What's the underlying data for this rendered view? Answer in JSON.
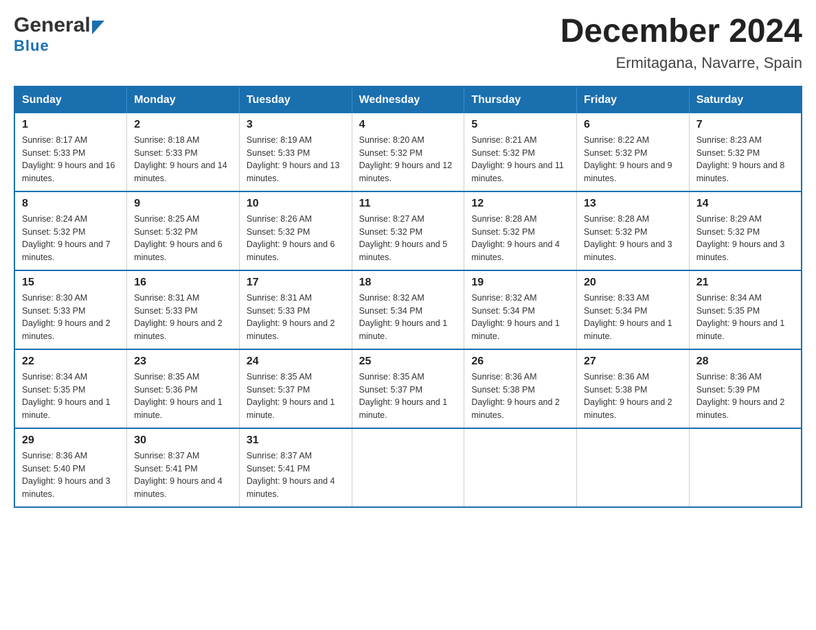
{
  "logo": {
    "general": "General",
    "blue": "Blue"
  },
  "title": {
    "month": "December 2024",
    "location": "Ermitagana, Navarre, Spain"
  },
  "days_of_week": [
    "Sunday",
    "Monday",
    "Tuesday",
    "Wednesday",
    "Thursday",
    "Friday",
    "Saturday"
  ],
  "weeks": [
    [
      {
        "day": "1",
        "sunrise": "8:17 AM",
        "sunset": "5:33 PM",
        "daylight": "9 hours and 16 minutes."
      },
      {
        "day": "2",
        "sunrise": "8:18 AM",
        "sunset": "5:33 PM",
        "daylight": "9 hours and 14 minutes."
      },
      {
        "day": "3",
        "sunrise": "8:19 AM",
        "sunset": "5:33 PM",
        "daylight": "9 hours and 13 minutes."
      },
      {
        "day": "4",
        "sunrise": "8:20 AM",
        "sunset": "5:32 PM",
        "daylight": "9 hours and 12 minutes."
      },
      {
        "day": "5",
        "sunrise": "8:21 AM",
        "sunset": "5:32 PM",
        "daylight": "9 hours and 11 minutes."
      },
      {
        "day": "6",
        "sunrise": "8:22 AM",
        "sunset": "5:32 PM",
        "daylight": "9 hours and 9 minutes."
      },
      {
        "day": "7",
        "sunrise": "8:23 AM",
        "sunset": "5:32 PM",
        "daylight": "9 hours and 8 minutes."
      }
    ],
    [
      {
        "day": "8",
        "sunrise": "8:24 AM",
        "sunset": "5:32 PM",
        "daylight": "9 hours and 7 minutes."
      },
      {
        "day": "9",
        "sunrise": "8:25 AM",
        "sunset": "5:32 PM",
        "daylight": "9 hours and 6 minutes."
      },
      {
        "day": "10",
        "sunrise": "8:26 AM",
        "sunset": "5:32 PM",
        "daylight": "9 hours and 6 minutes."
      },
      {
        "day": "11",
        "sunrise": "8:27 AM",
        "sunset": "5:32 PM",
        "daylight": "9 hours and 5 minutes."
      },
      {
        "day": "12",
        "sunrise": "8:28 AM",
        "sunset": "5:32 PM",
        "daylight": "9 hours and 4 minutes."
      },
      {
        "day": "13",
        "sunrise": "8:28 AM",
        "sunset": "5:32 PM",
        "daylight": "9 hours and 3 minutes."
      },
      {
        "day": "14",
        "sunrise": "8:29 AM",
        "sunset": "5:32 PM",
        "daylight": "9 hours and 3 minutes."
      }
    ],
    [
      {
        "day": "15",
        "sunrise": "8:30 AM",
        "sunset": "5:33 PM",
        "daylight": "9 hours and 2 minutes."
      },
      {
        "day": "16",
        "sunrise": "8:31 AM",
        "sunset": "5:33 PM",
        "daylight": "9 hours and 2 minutes."
      },
      {
        "day": "17",
        "sunrise": "8:31 AM",
        "sunset": "5:33 PM",
        "daylight": "9 hours and 2 minutes."
      },
      {
        "day": "18",
        "sunrise": "8:32 AM",
        "sunset": "5:34 PM",
        "daylight": "9 hours and 1 minute."
      },
      {
        "day": "19",
        "sunrise": "8:32 AM",
        "sunset": "5:34 PM",
        "daylight": "9 hours and 1 minute."
      },
      {
        "day": "20",
        "sunrise": "8:33 AM",
        "sunset": "5:34 PM",
        "daylight": "9 hours and 1 minute."
      },
      {
        "day": "21",
        "sunrise": "8:34 AM",
        "sunset": "5:35 PM",
        "daylight": "9 hours and 1 minute."
      }
    ],
    [
      {
        "day": "22",
        "sunrise": "8:34 AM",
        "sunset": "5:35 PM",
        "daylight": "9 hours and 1 minute."
      },
      {
        "day": "23",
        "sunrise": "8:35 AM",
        "sunset": "5:36 PM",
        "daylight": "9 hours and 1 minute."
      },
      {
        "day": "24",
        "sunrise": "8:35 AM",
        "sunset": "5:37 PM",
        "daylight": "9 hours and 1 minute."
      },
      {
        "day": "25",
        "sunrise": "8:35 AM",
        "sunset": "5:37 PM",
        "daylight": "9 hours and 1 minute."
      },
      {
        "day": "26",
        "sunrise": "8:36 AM",
        "sunset": "5:38 PM",
        "daylight": "9 hours and 2 minutes."
      },
      {
        "day": "27",
        "sunrise": "8:36 AM",
        "sunset": "5:38 PM",
        "daylight": "9 hours and 2 minutes."
      },
      {
        "day": "28",
        "sunrise": "8:36 AM",
        "sunset": "5:39 PM",
        "daylight": "9 hours and 2 minutes."
      }
    ],
    [
      {
        "day": "29",
        "sunrise": "8:36 AM",
        "sunset": "5:40 PM",
        "daylight": "9 hours and 3 minutes."
      },
      {
        "day": "30",
        "sunrise": "8:37 AM",
        "sunset": "5:41 PM",
        "daylight": "9 hours and 4 minutes."
      },
      {
        "day": "31",
        "sunrise": "8:37 AM",
        "sunset": "5:41 PM",
        "daylight": "9 hours and 4 minutes."
      },
      null,
      null,
      null,
      null
    ]
  ],
  "labels": {
    "sunrise": "Sunrise:",
    "sunset": "Sunset:",
    "daylight": "Daylight:"
  },
  "colors": {
    "header_bg": "#1a6faf",
    "border": "#1a6faf"
  }
}
